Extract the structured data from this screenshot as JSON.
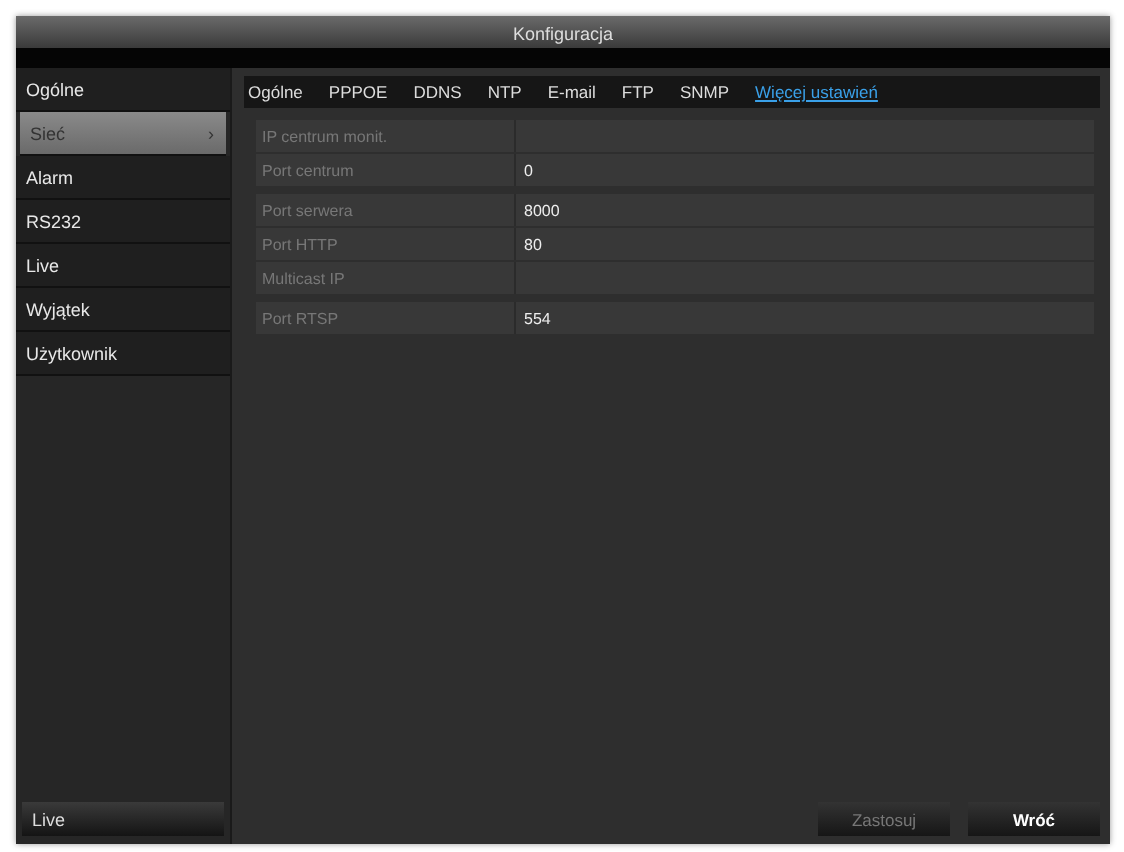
{
  "window": {
    "title": "Konfiguracja"
  },
  "sidebar": {
    "items": [
      {
        "label": "Ogólne",
        "selected": false
      },
      {
        "label": "Sieć",
        "selected": true,
        "arrow": "›"
      },
      {
        "label": "Alarm",
        "selected": false
      },
      {
        "label": "RS232",
        "selected": false
      },
      {
        "label": "Live",
        "selected": false
      },
      {
        "label": "Wyjątek",
        "selected": false
      },
      {
        "label": "Użytkownik",
        "selected": false
      }
    ],
    "bottom_button": "Live"
  },
  "tabs": [
    {
      "label": "Ogólne",
      "kind": "tab",
      "selected": false
    },
    {
      "label": "PPPOE",
      "kind": "tab",
      "selected": false
    },
    {
      "label": "DDNS",
      "kind": "tab",
      "selected": false
    },
    {
      "label": "NTP",
      "kind": "tab",
      "selected": false
    },
    {
      "label": "E-mail",
      "kind": "tab",
      "selected": false
    },
    {
      "label": "FTP",
      "kind": "tab",
      "selected": false
    },
    {
      "label": "SNMP",
      "kind": "tab",
      "selected": false
    },
    {
      "label": "Więcej ustawień",
      "kind": "link",
      "selected": false
    }
  ],
  "field_groups": [
    {
      "fields": [
        {
          "label": "IP centrum monit."
        },
        {
          "label": "Port centrum",
          "value": "0"
        }
      ]
    },
    {
      "fields": [
        {
          "label": "Port serwera",
          "value": "8000"
        },
        {
          "label": "Port HTTP",
          "value": "80"
        },
        {
          "label": "Multicast IP"
        }
      ]
    },
    {
      "fields": [
        {
          "label": "Port RTSP",
          "value": "554"
        }
      ]
    }
  ],
  "buttons": [
    {
      "label": "Zastosuj",
      "disabled": true
    },
    {
      "label": "Wróć",
      "disabled": false
    }
  ]
}
